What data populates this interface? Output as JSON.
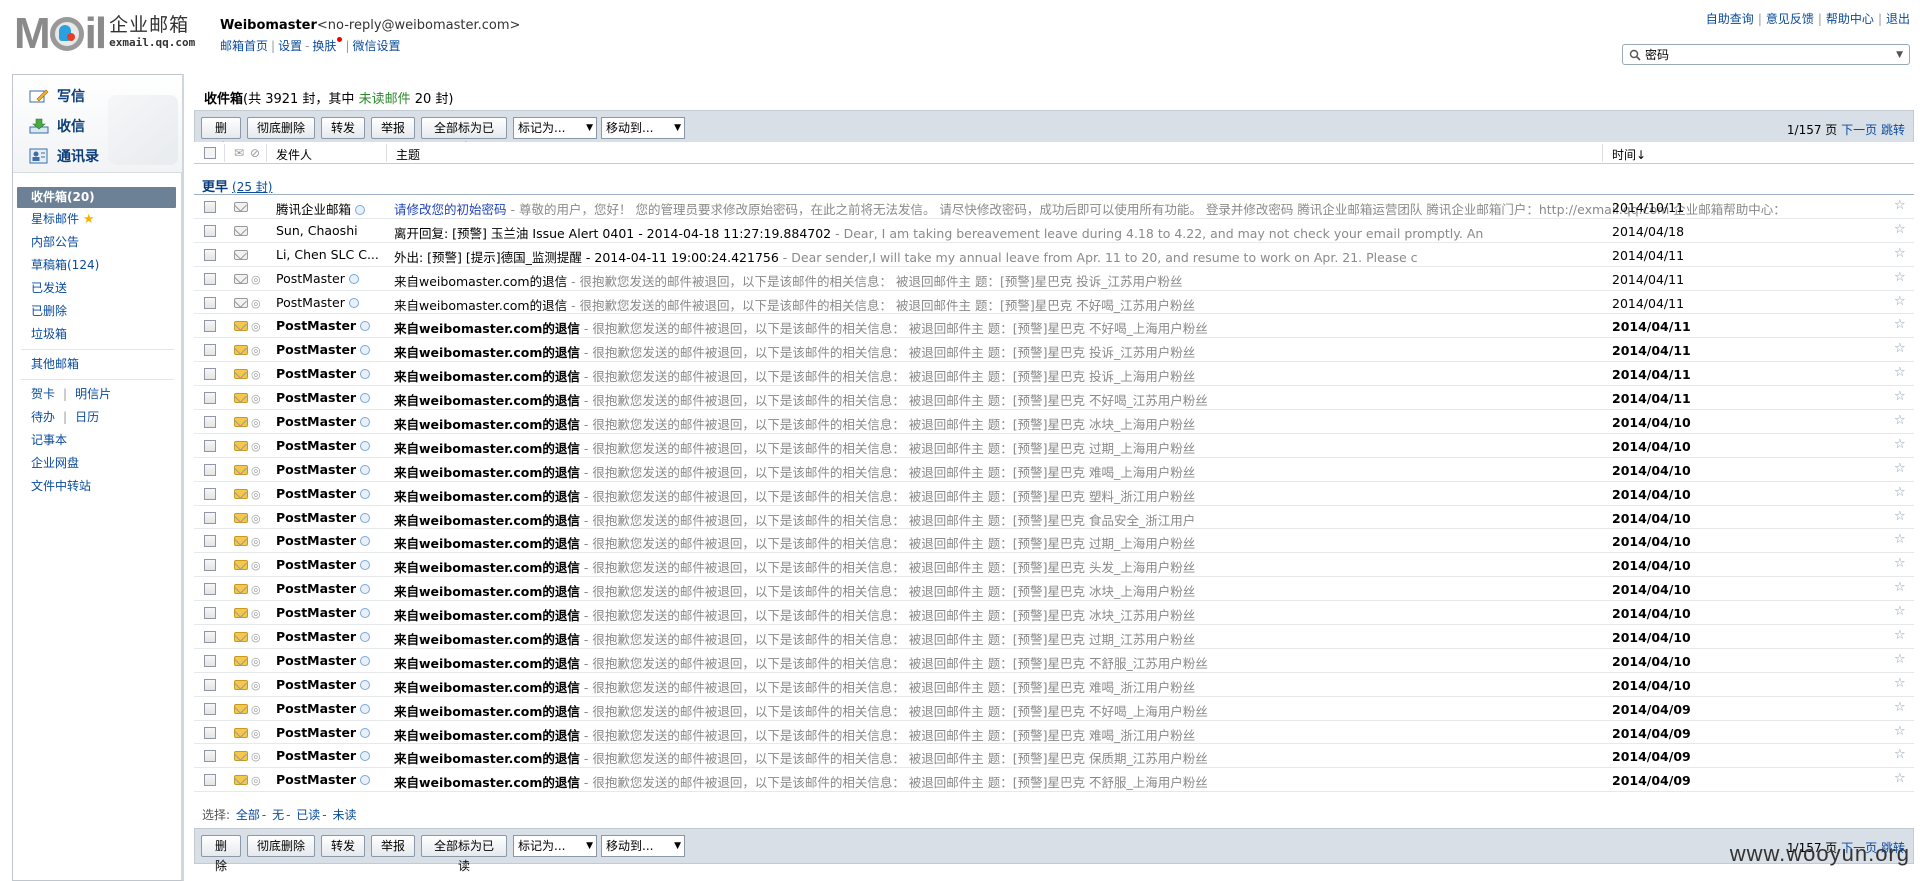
{
  "brand": {
    "cn": "企业邮箱",
    "url": "exmail.qq.com"
  },
  "account": {
    "name": "Weibomaster",
    "addr": "<no-reply@weibomaster.com>",
    "links": [
      "邮箱首页",
      "设置",
      "换肤",
      "微信设置"
    ]
  },
  "toplinks": [
    "自助查询",
    "意见反馈",
    "帮助中心",
    "退出"
  ],
  "search": {
    "value": "密码"
  },
  "quick": {
    "compose": "写信",
    "inbox": "收信",
    "contacts": "通讯录"
  },
  "folders": {
    "inbox": "收件箱(20)",
    "starred": "星标邮件",
    "notice": "内部公告",
    "drafts": "草稿箱(124)",
    "sent": "已发送",
    "deleted": "已删除",
    "spam": "垃圾箱",
    "other": "其他邮箱",
    "card": "贺卡",
    "postcard": "明信片",
    "todo": "待办",
    "calendar": "日历",
    "notes": "记事本",
    "disk": "企业网盘",
    "transfer": "文件中转站"
  },
  "main": {
    "title": "收件箱",
    "stats_a": "(共 3921 封，其中 ",
    "unread": "未读邮件",
    "stats_b": " 20 封)"
  },
  "toolbar": {
    "delete": "删除",
    "purge": "彻底删除",
    "forward": "转发",
    "report": "举报",
    "markall": "全部标为已读",
    "markas": "标记为...",
    "moveto": "移动到...",
    "pager": "1/157 页",
    "next": "下一页",
    "jump": "跳转"
  },
  "columns": {
    "from": "发件人",
    "subject": "主题",
    "time": "时间↓"
  },
  "group": {
    "label": "更早",
    "count": "(25 封)"
  },
  "rows": [
    {
      "from": "腾讯企业邮箱",
      "subj": "请修改您的初始密码",
      "prev": " - 尊敬的用户，您好！ 您的管理员要求修改原始密码，在此之前将无法发信。 请尽快修改密码，成功后即可以使用所有功能。 登录并修改密码 腾讯企业邮箱运营团队 腾讯企业邮箱门户：http://exmail.qq.com 企业邮箱帮助中心：htt...",
      "date": "2014/10/11"
    },
    {
      "from": "Sun, Chaoshi",
      "subj": "离开回复: [预警] 玉兰油 Issue Alert 0401 - 2014-04-18 11:27:19.884702",
      "prev": " - Dear,  I am taking bereavement leave during 4.18 to 4.22, and may not check your email promptly. An",
      "date": "2014/04/18"
    },
    {
      "from": "Li, Chen SLC C...",
      "subj": "外出: [预警] [提示]德国_监测提醒 - 2014-04-11 19:00:24.421756",
      "prev": " - Dear sender,I will take my annual leave from Apr. 11 to 20, and resume to work on Apr. 21. Please c",
      "date": "2014/04/11"
    },
    {
      "from": "PostMaster",
      "subj": "来自weibomaster.com的退信",
      "prev": " - 很抱歉您发送的邮件被退回，以下是该邮件的相关信息：   被退回邮件主 题：[预警]星巴克 投诉_江苏用户粉丝",
      "date": "2014/04/11"
    },
    {
      "from": "PostMaster",
      "subj": "来自weibomaster.com的退信",
      "prev": " - 很抱歉您发送的邮件被退回，以下是该邮件的相关信息：   被退回邮件主 题：[预警]星巴克 不好喝_江苏用户粉丝",
      "date": "2014/04/11"
    },
    {
      "from": "PostMaster",
      "subj": "来自weibomaster.com的退信",
      "prev": " - 很抱歉您发送的邮件被退回，以下是该邮件的相关信息：   被退回邮件主 题：[预警]星巴克 不好喝_上海用户粉丝",
      "date": "2014/04/11"
    },
    {
      "from": "PostMaster",
      "subj": "来自weibomaster.com的退信",
      "prev": " - 很抱歉您发送的邮件被退回，以下是该邮件的相关信息：   被退回邮件主 题：[预警]星巴克 投诉_江苏用户粉丝",
      "date": "2014/04/11"
    },
    {
      "from": "PostMaster",
      "subj": "来自weibomaster.com的退信",
      "prev": " - 很抱歉您发送的邮件被退回，以下是该邮件的相关信息：   被退回邮件主 题：[预警]星巴克 投诉_上海用户粉丝",
      "date": "2014/04/11"
    },
    {
      "from": "PostMaster",
      "subj": "来自weibomaster.com的退信",
      "prev": " - 很抱歉您发送的邮件被退回，以下是该邮件的相关信息：   被退回邮件主 题：[预警]星巴克 不好喝_江苏用户粉丝",
      "date": "2014/04/11"
    },
    {
      "from": "PostMaster",
      "subj": "来自weibomaster.com的退信",
      "prev": " - 很抱歉您发送的邮件被退回，以下是该邮件的相关信息：   被退回邮件主 题：[预警]星巴克 冰块_上海用户粉丝",
      "date": "2014/04/10"
    },
    {
      "from": "PostMaster",
      "subj": "来自weibomaster.com的退信",
      "prev": " - 很抱歉您发送的邮件被退回，以下是该邮件的相关信息：   被退回邮件主 题：[预警]星巴克 过期_上海用户粉丝",
      "date": "2014/04/10"
    },
    {
      "from": "PostMaster",
      "subj": "来自weibomaster.com的退信",
      "prev": " - 很抱歉您发送的邮件被退回，以下是该邮件的相关信息：   被退回邮件主 题：[预警]星巴克 难喝_上海用户粉丝",
      "date": "2014/04/10"
    },
    {
      "from": "PostMaster",
      "subj": "来自weibomaster.com的退信",
      "prev": " - 很抱歉您发送的邮件被退回，以下是该邮件的相关信息：   被退回邮件主 题：[预警]星巴克 塑料_浙江用户粉丝",
      "date": "2014/04/10"
    },
    {
      "from": "PostMaster",
      "subj": "来自weibomaster.com的退信",
      "prev": " - 很抱歉您发送的邮件被退回，以下是该邮件的相关信息：   被退回邮件主 题：[预警]星巴克 食品安全_浙江用户",
      "date": "2014/04/10"
    },
    {
      "from": "PostMaster",
      "subj": "来自weibomaster.com的退信",
      "prev": " - 很抱歉您发送的邮件被退回，以下是该邮件的相关信息：   被退回邮件主 题：[预警]星巴克 过期_上海用户粉丝",
      "date": "2014/04/10"
    },
    {
      "from": "PostMaster",
      "subj": "来自weibomaster.com的退信",
      "prev": " - 很抱歉您发送的邮件被退回，以下是该邮件的相关信息：   被退回邮件主 题：[预警]星巴克 头发_上海用户粉丝",
      "date": "2014/04/10"
    },
    {
      "from": "PostMaster",
      "subj": "来自weibomaster.com的退信",
      "prev": " - 很抱歉您发送的邮件被退回，以下是该邮件的相关信息：   被退回邮件主 题：[预警]星巴克 冰块_上海用户粉丝",
      "date": "2014/04/10"
    },
    {
      "from": "PostMaster",
      "subj": "来自weibomaster.com的退信",
      "prev": " - 很抱歉您发送的邮件被退回，以下是该邮件的相关信息：   被退回邮件主 题：[预警]星巴克 冰块_江苏用户粉丝",
      "date": "2014/04/10"
    },
    {
      "from": "PostMaster",
      "subj": "来自weibomaster.com的退信",
      "prev": " - 很抱歉您发送的邮件被退回，以下是该邮件的相关信息：   被退回邮件主 题：[预警]星巴克 过期_江苏用户粉丝",
      "date": "2014/04/10"
    },
    {
      "from": "PostMaster",
      "subj": "来自weibomaster.com的退信",
      "prev": " - 很抱歉您发送的邮件被退回，以下是该邮件的相关信息：   被退回邮件主 题：[预警]星巴克 不舒服_江苏用户粉丝",
      "date": "2014/04/10"
    },
    {
      "from": "PostMaster",
      "subj": "来自weibomaster.com的退信",
      "prev": " - 很抱歉您发送的邮件被退回，以下是该邮件的相关信息：   被退回邮件主 题：[预警]星巴克 难喝_浙江用户粉丝",
      "date": "2014/04/10"
    },
    {
      "from": "PostMaster",
      "subj": "来自weibomaster.com的退信",
      "prev": " - 很抱歉您发送的邮件被退回，以下是该邮件的相关信息：   被退回邮件主 题：[预警]星巴克 不好喝_上海用户粉丝",
      "date": "2014/04/09"
    },
    {
      "from": "PostMaster",
      "subj": "来自weibomaster.com的退信",
      "prev": " - 很抱歉您发送的邮件被退回，以下是该邮件的相关信息：   被退回邮件主 题：[预警]星巴克 难喝_浙江用户粉丝",
      "date": "2014/04/09"
    },
    {
      "from": "PostMaster",
      "subj": "来自weibomaster.com的退信",
      "prev": " - 很抱歉您发送的邮件被退回，以下是该邮件的相关信息：   被退回邮件主 题：[预警]星巴克 保质期_江苏用户粉丝",
      "date": "2014/04/09"
    },
    {
      "from": "PostMaster",
      "subj": "来自weibomaster.com的退信",
      "prev": " - 很抱歉您发送的邮件被退回，以下是该邮件的相关信息：   被退回邮件主 题：[预警]星巴克 不舒服_上海用户粉丝",
      "date": "2014/04/09"
    }
  ],
  "selection": {
    "label": "选择:",
    "all": "全部",
    "none": "无",
    "read": "已读",
    "unread": "未读",
    "sep": "-"
  },
  "watermark": "www.wooyun.org"
}
